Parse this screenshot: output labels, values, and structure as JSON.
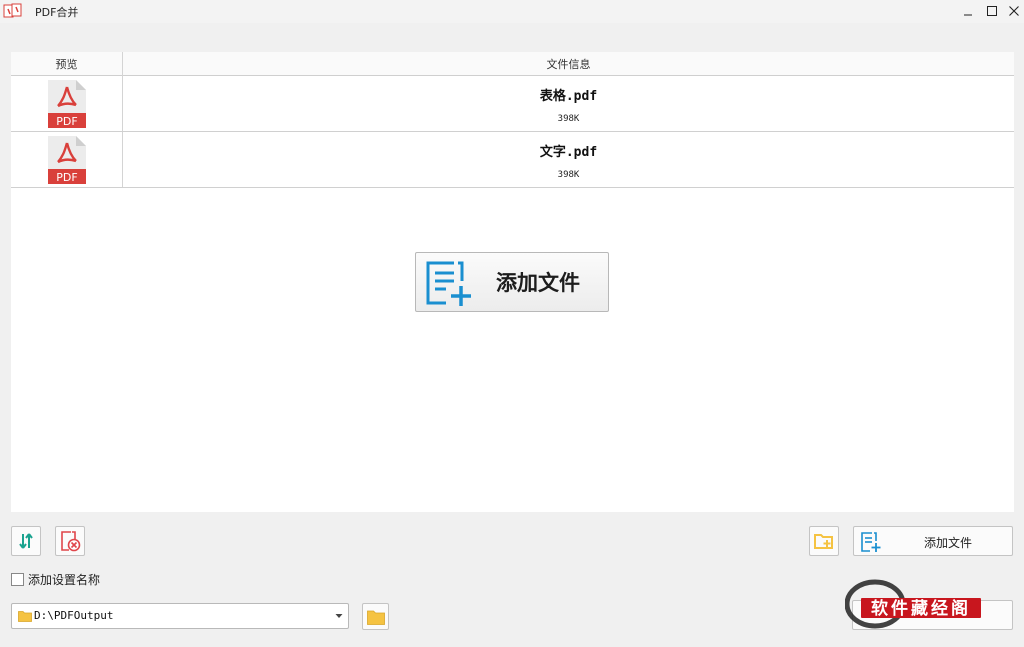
{
  "window": {
    "title": "PDF合并",
    "controls": [
      "minimize-icon",
      "maximize-icon",
      "close-icon"
    ]
  },
  "table": {
    "columns": [
      "预览",
      "文件信息"
    ],
    "rows": [
      {
        "thumbnail_label": "PDF",
        "name": "表格.pdf",
        "size": "398K"
      },
      {
        "thumbnail_label": "PDF",
        "name": "文字.pdf",
        "size": "398K"
      }
    ]
  },
  "main": {
    "add_file_label": "添加文件"
  },
  "toolbar": {
    "add_file_label": "添加文件",
    "add_setting_name_label": "添加设置名称",
    "add_setting_name_checked": false,
    "output_path": "D:\\PDFOutput"
  },
  "watermark": {
    "text": "软件藏经阁"
  },
  "colors": {
    "pdf_red": "#d9403b",
    "accent_blue": "#1a8fd0",
    "folder_yellow": "#f5c342",
    "delete_red": "#e0464b",
    "sort_teal": "#1aa38f"
  }
}
